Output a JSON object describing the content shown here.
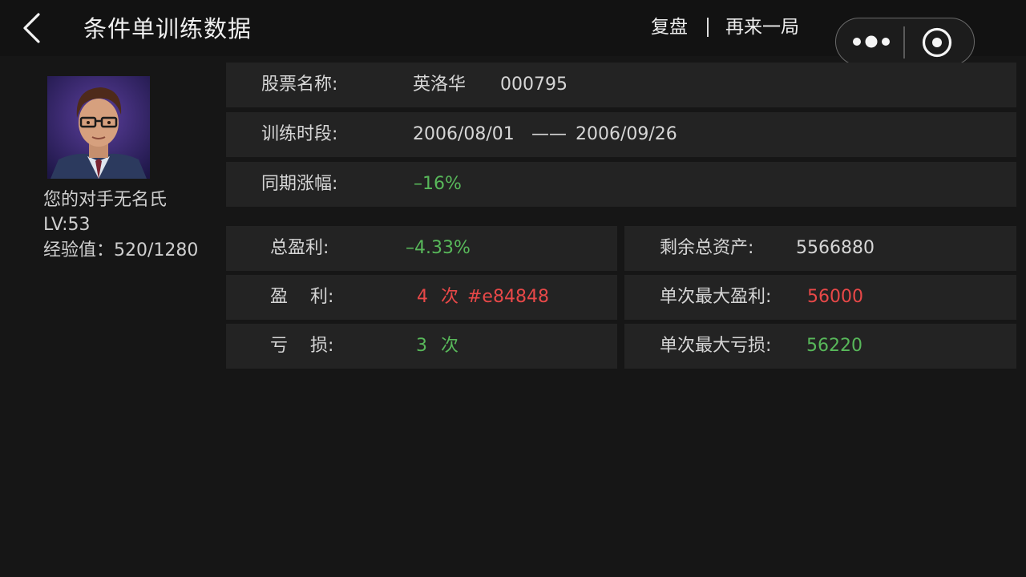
{
  "header": {
    "title": "条件单训练数据",
    "replay_label": "复盘",
    "again_label": "再来一局"
  },
  "user": {
    "opponent": "您的对手无名氏",
    "level": "LV:53",
    "exp": "经验值：520/1280"
  },
  "stock": {
    "name_label": "股票名称:",
    "name": "英洛华",
    "code": "000795",
    "period_label": "训练时段:",
    "start": "2006/08/01",
    "dash": "——",
    "end": "2006/09/26",
    "change_label": "同期涨幅:",
    "change": "–16%"
  },
  "stats": {
    "total_profit_label": "总盈利:",
    "total_profit": "–4.33%",
    "remaining_label": "剩余总资产:",
    "remaining": "5566880",
    "win_label": "盈    利:",
    "win_count": "4",
    "win_unit": "次",
    "win_color_text": "#e84848",
    "max_win_label": "单次最大盈利:",
    "max_win": "56000",
    "loss_label": "亏    损:",
    "loss_count": "3",
    "loss_unit": "次",
    "max_loss_label": "单次最大亏损:",
    "max_loss": "56220"
  },
  "colors": {
    "up": "#e84848",
    "down": "#58b85a",
    "background": "#161616",
    "row": "#232323"
  },
  "icons": {
    "back": "chevron-left-icon",
    "more": "more-dots-icon",
    "close": "target-close-icon"
  }
}
